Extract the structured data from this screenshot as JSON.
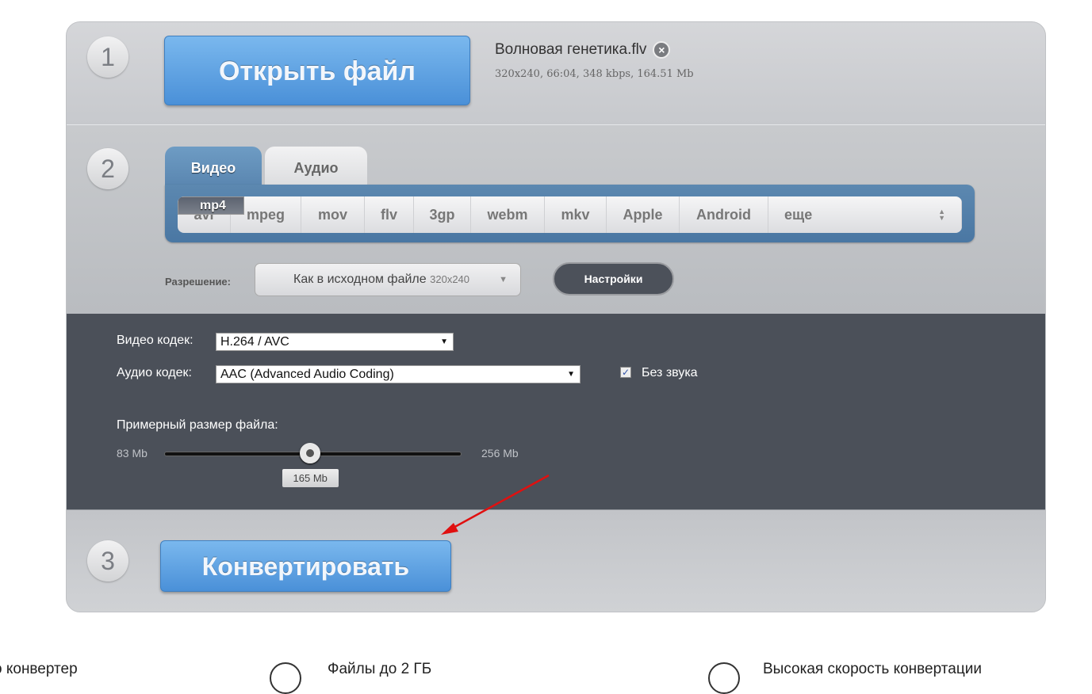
{
  "step1": {
    "number": "1",
    "open_label": "Открыть файл",
    "file_name": "Волновая генетика.flv",
    "file_meta": "320x240, 66:04, 348 kbps, 164.51 Mb"
  },
  "step2": {
    "number": "2",
    "tabs": [
      "Видео",
      "Аудио"
    ],
    "active_tab": "Видео",
    "formats": [
      "mp4",
      "avi",
      "mpeg",
      "mov",
      "flv",
      "3gp",
      "webm",
      "mkv",
      "Apple",
      "Android",
      "еще"
    ],
    "selected_format": "mp4",
    "resolution_label": "Разрешение:",
    "resolution_value": "Как в исходном файле",
    "resolution_size": "320x240",
    "settings_label": "Настройки"
  },
  "settings": {
    "video_codec_label": "Видео кодек:",
    "video_codec": "H.264 / AVC",
    "audio_codec_label": "Аудио кодек:",
    "audio_codec": "AAC (Advanced Audio Coding)",
    "no_sound_label": "Без звука",
    "no_sound_checked": true,
    "size_label": "Примерный размер файла:",
    "size_min": "83 Mb",
    "size_max": "256 Mb",
    "size_value": "165 Mb",
    "size_min_value": 83,
    "size_max_value": 256,
    "size_current_value": 165
  },
  "step3": {
    "number": "3",
    "convert_label": "Конвертировать"
  },
  "annotation": {
    "arrow_color": "#e01010"
  },
  "footer": {
    "items": [
      "о конвертер",
      "Файлы до 2 ГБ",
      "Высокая скорость конвертации"
    ]
  }
}
